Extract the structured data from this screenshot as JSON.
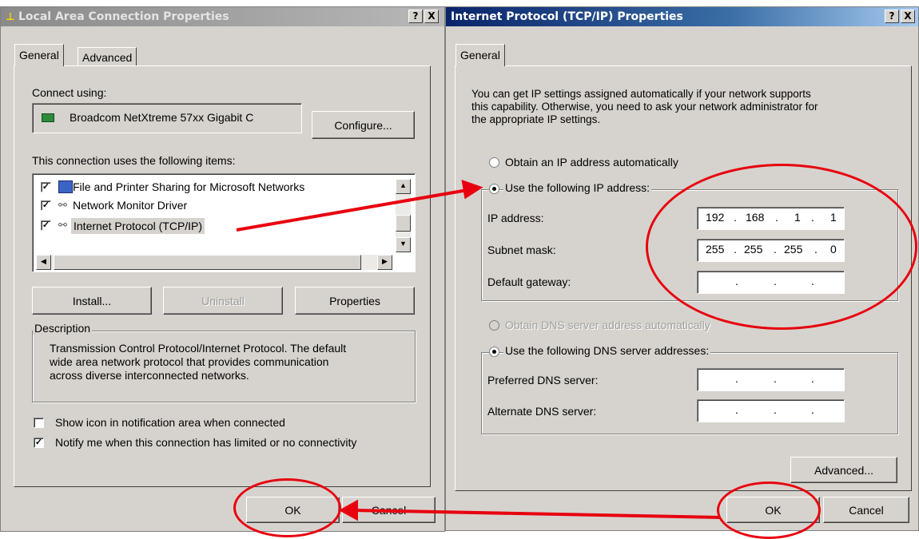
{
  "left_window": {
    "title": "Local Area Connection Properties",
    "help_btn": "?",
    "close_btn": "X",
    "tabs": [
      "General",
      "Advanced"
    ],
    "connect_using_label": "Connect using:",
    "adapter_name": "Broadcom NetXtreme 57xx Gigabit C",
    "configure_button": "Configure...",
    "items_label": "This connection uses the following items:",
    "items": [
      {
        "label": "File and Printer Sharing for Microsoft Networks",
        "checked": true,
        "icon": "printer-share-icon"
      },
      {
        "label": "Network Monitor Driver",
        "checked": true,
        "icon": "network-protocol-icon"
      },
      {
        "label": "Internet Protocol (TCP/IP)",
        "checked": true,
        "icon": "network-protocol-icon",
        "selected": true
      }
    ],
    "install_button": "Install...",
    "uninstall_button": "Uninstall",
    "properties_button": "Properties",
    "description_label": "Description",
    "description_lines": [
      "Transmission Control Protocol/Internet Protocol. The default",
      "wide area network protocol that provides communication",
      "across diverse interconnected networks."
    ],
    "show_icon_label": "Show icon in notification area when connected",
    "show_icon_checked": false,
    "notify_label": "Notify me when this connection has limited or no connectivity",
    "notify_checked": true,
    "ok_button": "OK",
    "cancel_button": "Cancel"
  },
  "right_window": {
    "title": "Internet Protocol (TCP/IP) Properties",
    "help_btn": "?",
    "close_btn": "X",
    "tab": "General",
    "intro_lines": [
      "You can get IP settings assigned automatically if your network supports",
      "this capability. Otherwise, you need to ask your network administrator for",
      "the appropriate IP settings."
    ],
    "obtain_ip_auto": "Obtain an IP address automatically",
    "use_following_ip": "Use the following IP address:",
    "ip_address_label": "IP address:",
    "ip_address": [
      "192",
      "168",
      "1",
      "1"
    ],
    "subnet_mask_label": "Subnet mask:",
    "subnet_mask": [
      "255",
      "255",
      "255",
      "0"
    ],
    "default_gateway_label": "Default gateway:",
    "default_gateway": [
      "",
      "",
      "",
      ""
    ],
    "obtain_dns_auto": "Obtain DNS server address automatically",
    "use_following_dns": "Use the following DNS server addresses:",
    "preferred_dns_label": "Preferred DNS server:",
    "alternate_dns_label": "Alternate DNS server:",
    "advanced_button": "Advanced...",
    "ok_button": "OK",
    "cancel_button": "Cancel"
  },
  "annotation_color": "#e8000f",
  "dialog_face_color": "#d6d3ce",
  "selection_color": "#d6d3ce"
}
